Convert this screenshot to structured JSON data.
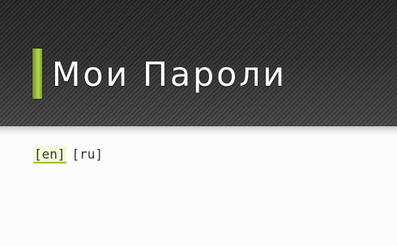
{
  "header": {
    "title": "Мои Пароли"
  },
  "languages": [
    {
      "code": "en",
      "label": "[en]",
      "active": true
    },
    {
      "code": "ru",
      "label": "[ru]",
      "active": false
    }
  ],
  "colors": {
    "accent": "#9cc23a",
    "header_bg": "#333333",
    "title_text": "#ffffff"
  }
}
